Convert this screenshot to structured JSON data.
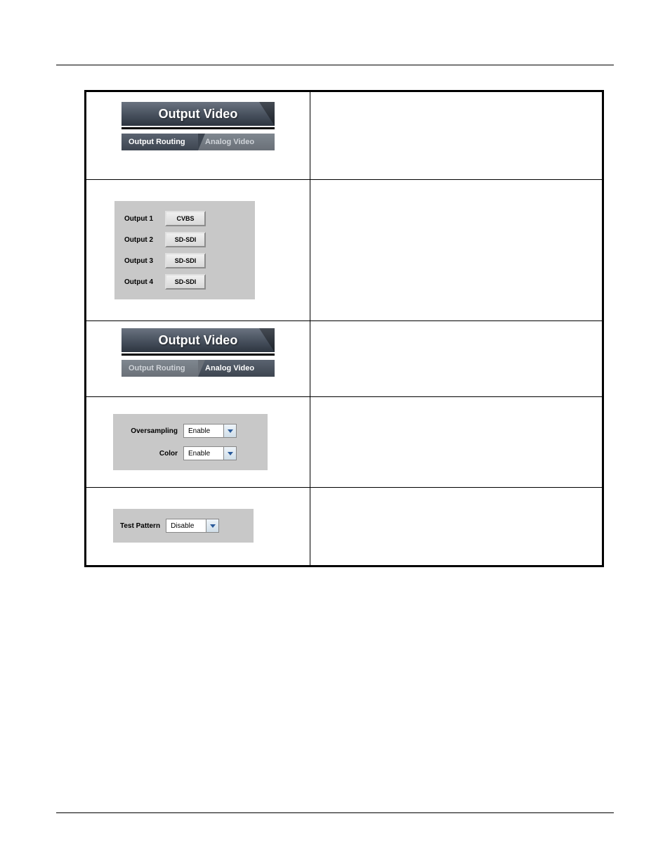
{
  "banner1": {
    "title": "Output Video",
    "tab_active": "Output Routing",
    "tab_inactive": "Analog Video"
  },
  "routing": {
    "rows": [
      {
        "label": "Output 1",
        "value": "CVBS"
      },
      {
        "label": "Output 2",
        "value": "SD-SDI"
      },
      {
        "label": "Output 3",
        "value": "SD-SDI"
      },
      {
        "label": "Output 4",
        "value": "SD-SDI"
      }
    ]
  },
  "banner2": {
    "title": "Output Video",
    "tab_inactive": "Output Routing",
    "tab_active": "Analog Video"
  },
  "analog": {
    "oversampling_label": "Oversampling",
    "oversampling_value": "Enable",
    "color_label": "Color",
    "color_value": "Enable"
  },
  "test": {
    "label": "Test Pattern",
    "value": "Disable"
  }
}
